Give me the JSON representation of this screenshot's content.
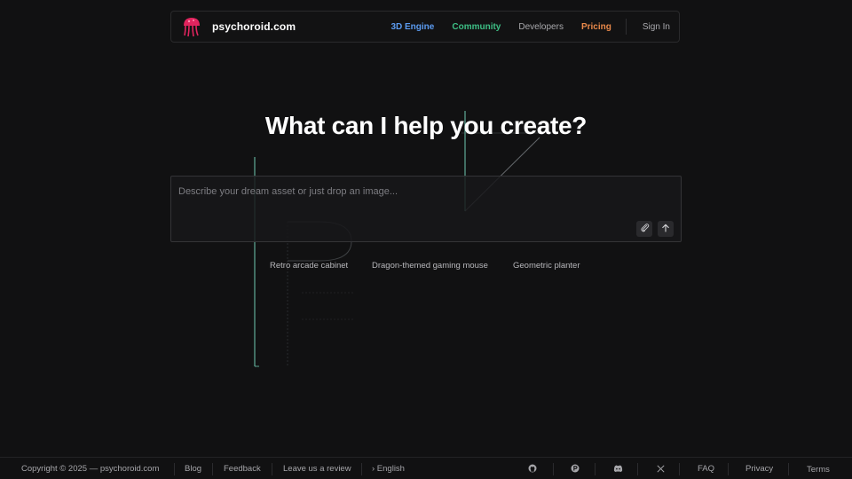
{
  "header": {
    "brand_name": "psychoroid.com",
    "nav": {
      "engine": "3D Engine",
      "community": "Community",
      "developers": "Developers",
      "pricing": "Pricing",
      "signin": "Sign In"
    },
    "colors": {
      "engine": "#5b9bf0",
      "community": "#3dbf85",
      "pricing": "#e9894a",
      "logo": "#e0245e"
    }
  },
  "hero": {
    "headline": "What can I help you create?"
  },
  "prompt": {
    "placeholder": "Describe your dream asset or just drop an image...",
    "value": "",
    "attach_icon": "paperclip-icon",
    "send_icon": "arrow-up-icon"
  },
  "suggestions": [
    "Retro arcade cabinet",
    "Dragon-themed gaming mouse",
    "Geometric planter"
  ],
  "footer": {
    "copyright": "Copyright © 2025 — psychoroid.com",
    "blog": "Blog",
    "feedback": "Feedback",
    "review": "Leave us a review",
    "language": "› English",
    "faq": "FAQ",
    "privacy": "Privacy",
    "terms": "Terms",
    "social_icons": [
      "github-icon",
      "product-hunt-icon",
      "discord-icon",
      "x-icon"
    ]
  }
}
